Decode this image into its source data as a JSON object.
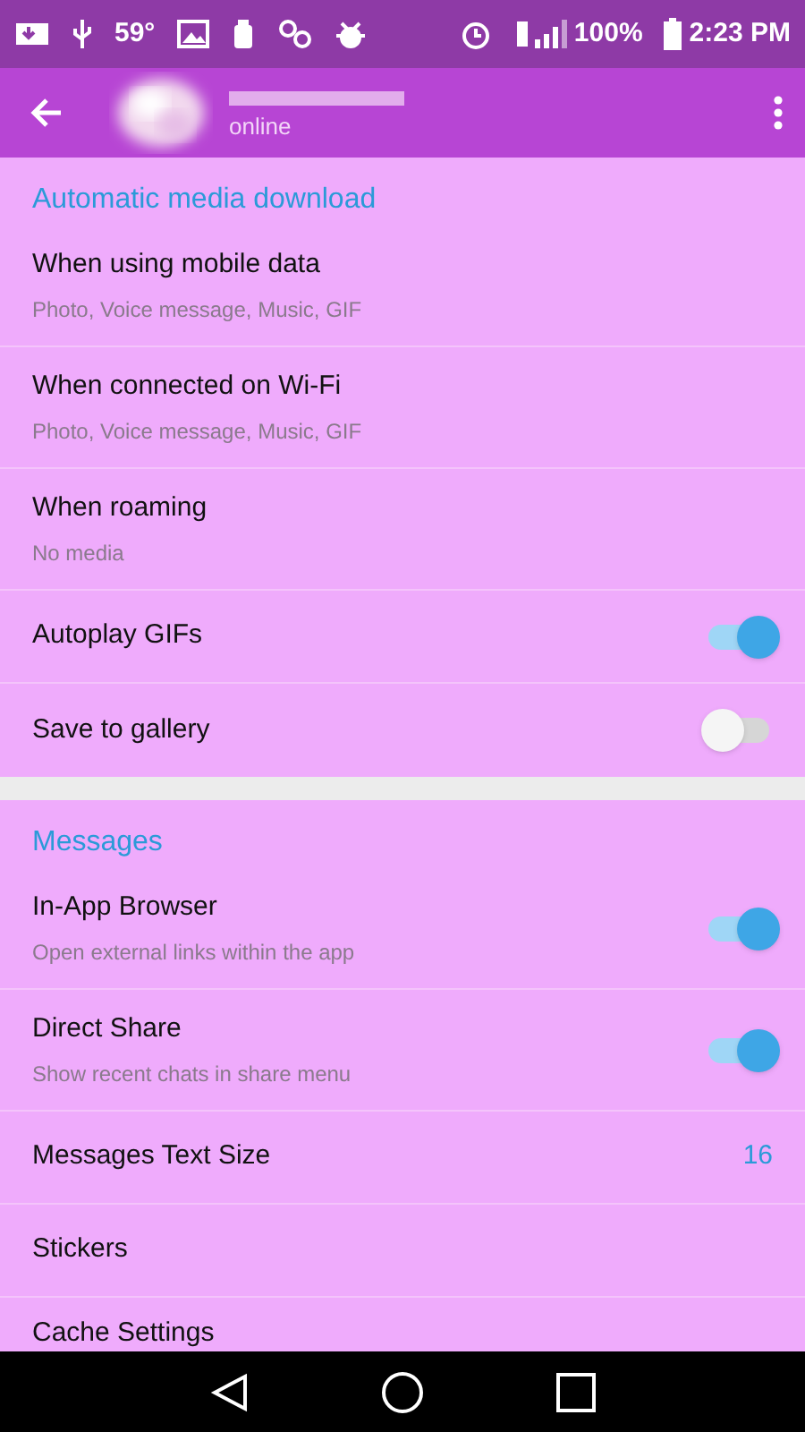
{
  "status_bar": {
    "temperature": "59°",
    "battery": "100%",
    "time": "2:23 PM"
  },
  "app_bar": {
    "subtitle": "online"
  },
  "sections": [
    {
      "title": "Automatic media download",
      "items": [
        {
          "kind": "detail",
          "title": "When using mobile data",
          "subtitle": "Photo, Voice message, Music, GIF"
        },
        {
          "kind": "detail",
          "title": "When connected on Wi-Fi",
          "subtitle": "Photo, Voice message, Music, GIF"
        },
        {
          "kind": "detail",
          "title": "When roaming",
          "subtitle": "No media"
        },
        {
          "kind": "toggle",
          "title": "Autoplay GIFs",
          "on": true
        },
        {
          "kind": "toggle",
          "title": "Save to gallery",
          "on": false
        }
      ]
    },
    {
      "title": "Messages",
      "items": [
        {
          "kind": "toggle",
          "title": "In-App Browser",
          "subtitle": "Open external links within the app",
          "on": true
        },
        {
          "kind": "toggle",
          "title": "Direct Share",
          "subtitle": "Show recent chats in share menu",
          "on": true
        },
        {
          "kind": "value",
          "title": "Messages Text Size",
          "value": "16"
        },
        {
          "kind": "plain",
          "title": "Stickers"
        },
        {
          "kind": "plain",
          "title": "Cache Settings"
        }
      ]
    }
  ]
}
